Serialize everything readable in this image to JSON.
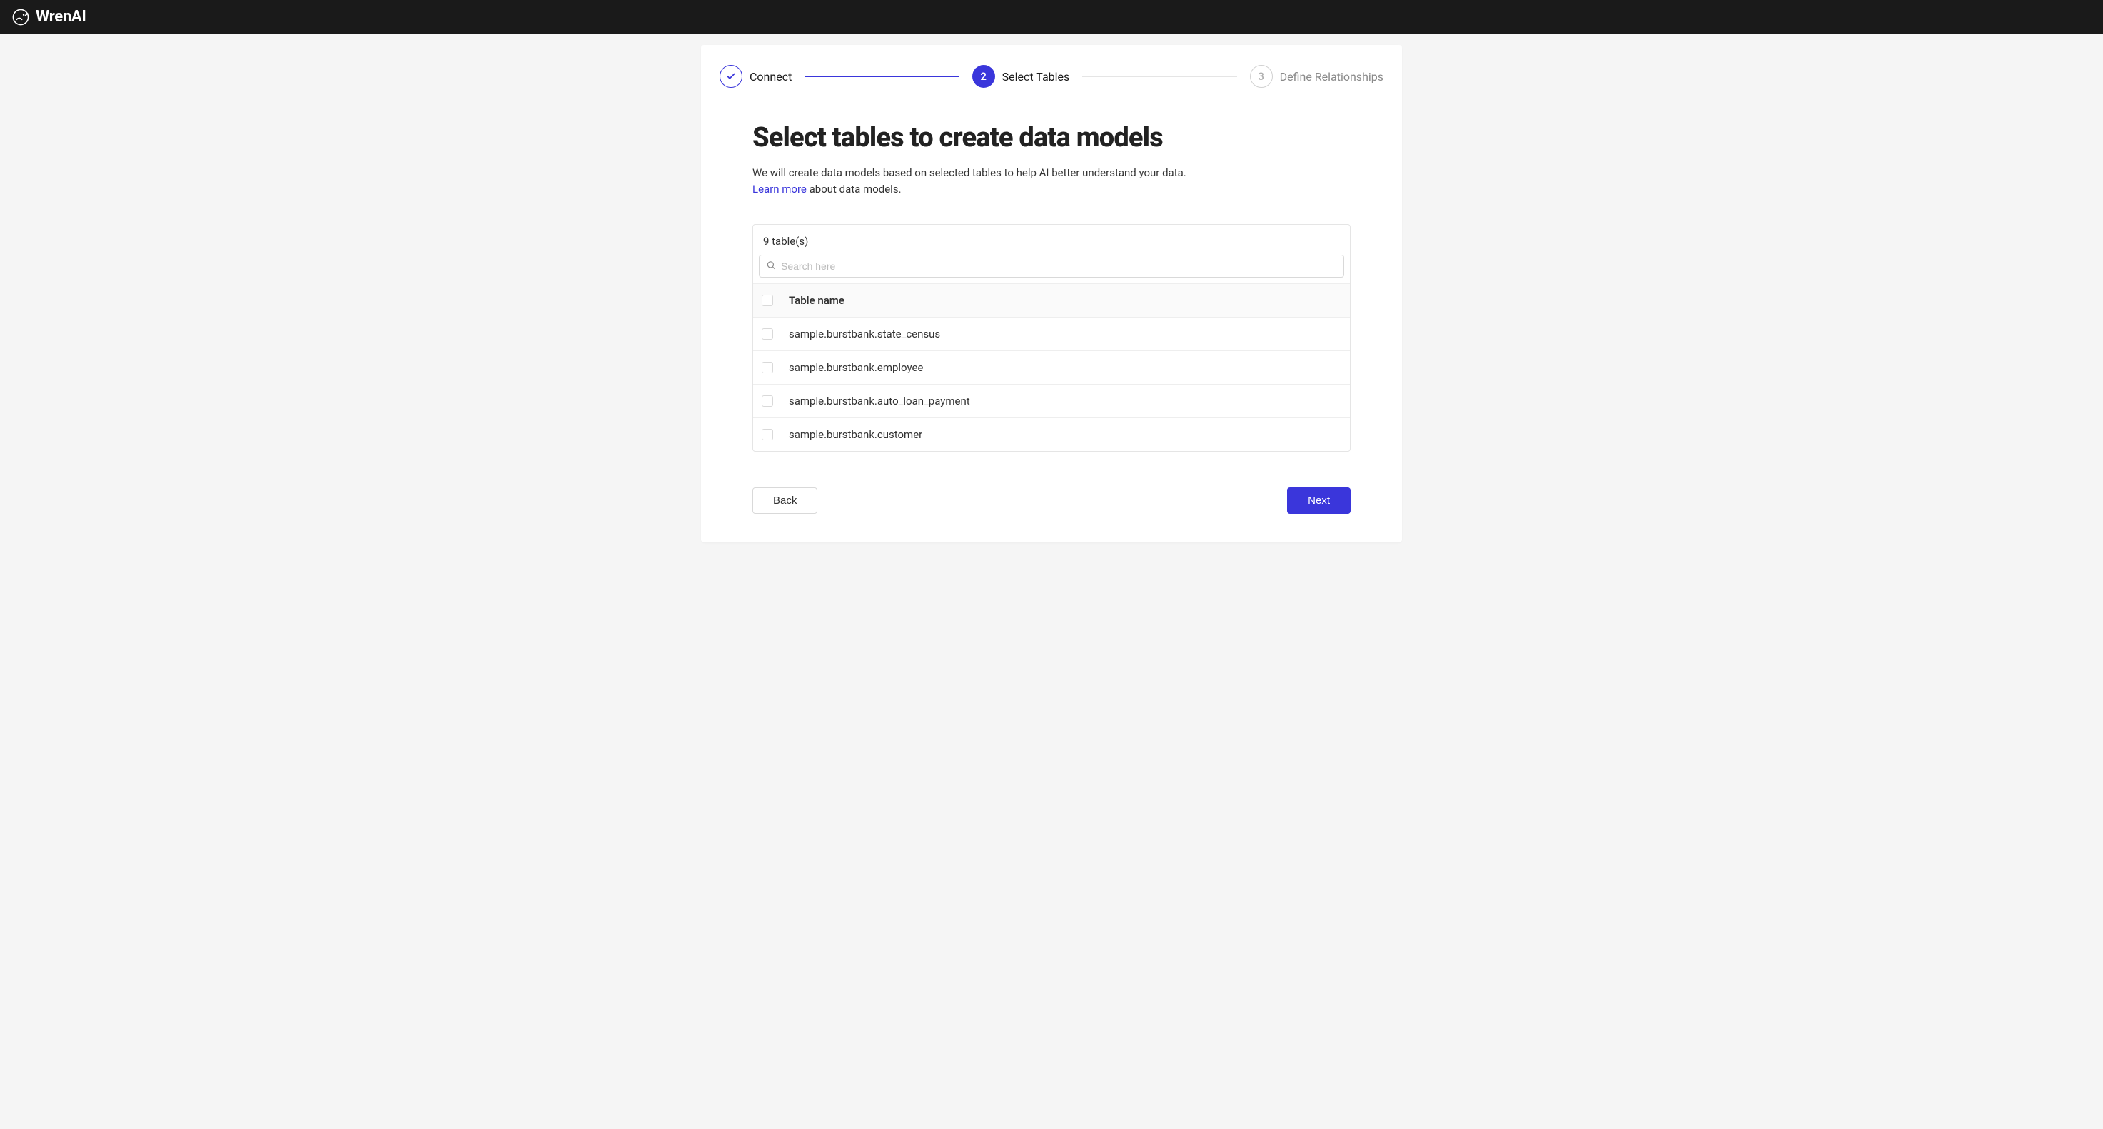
{
  "brand": "WrenAI",
  "stepper": {
    "step1": {
      "label": "Connect"
    },
    "step2": {
      "number": "2",
      "label": "Select Tables"
    },
    "step3": {
      "number": "3",
      "label": "Define Relationships"
    }
  },
  "page": {
    "title": "Select tables to create data models",
    "subtitle_before": "We will create data models based on selected tables to help AI better understand your data.",
    "learn_more": "Learn more",
    "subtitle_after": " about data models."
  },
  "table_panel": {
    "count_text": "9 table(s)",
    "search_placeholder": "Search here",
    "column_header": "Table name",
    "rows": [
      "sample.burstbank.state_census",
      "sample.burstbank.employee",
      "sample.burstbank.auto_loan_payment",
      "sample.burstbank.customer"
    ]
  },
  "actions": {
    "back": "Back",
    "next": "Next"
  }
}
